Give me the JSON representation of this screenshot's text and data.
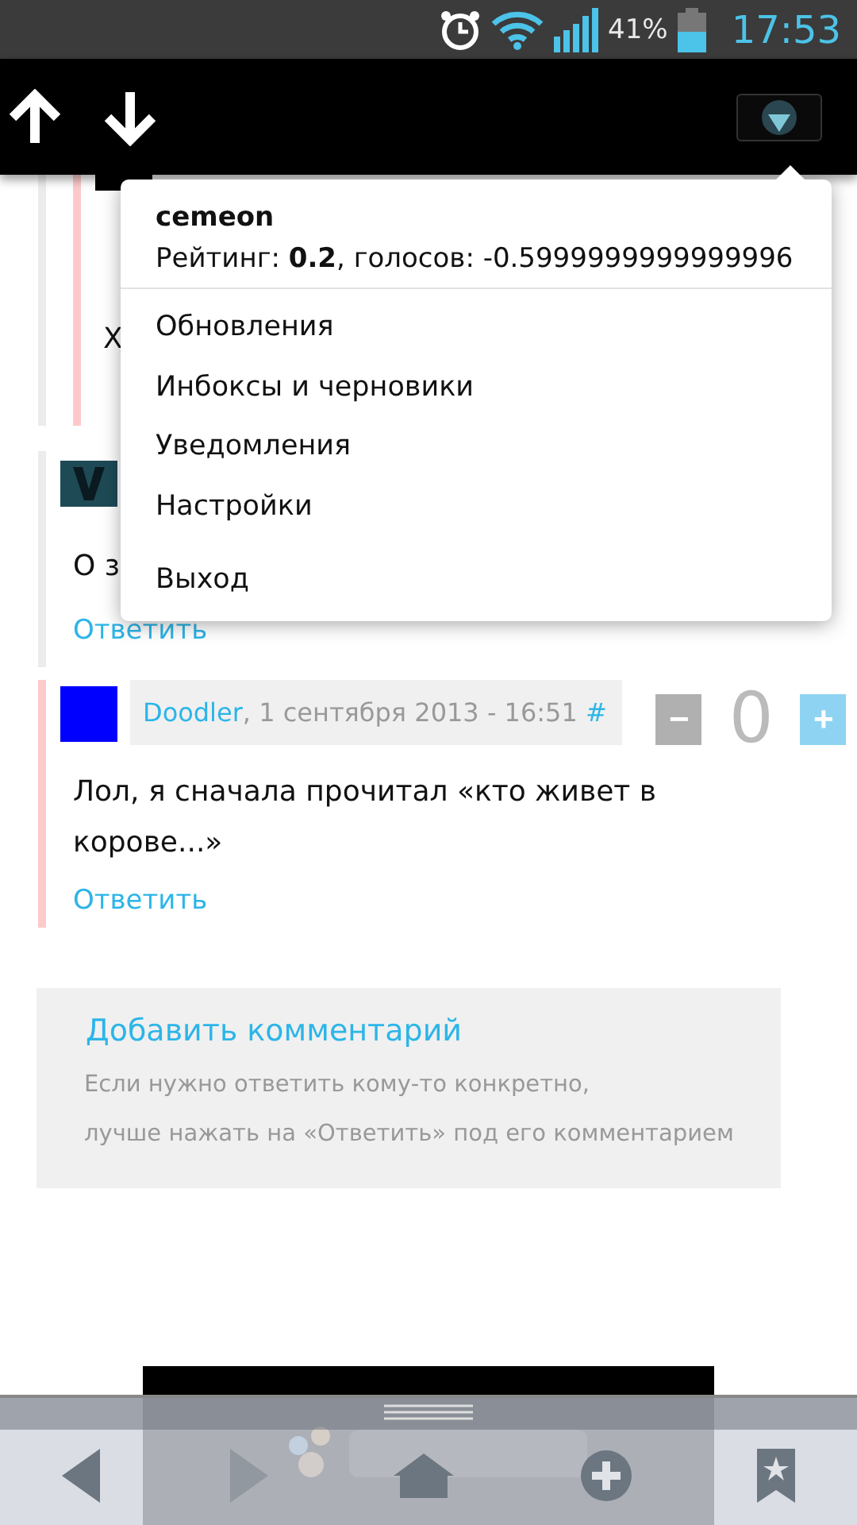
{
  "status_bar": {
    "battery": "41%",
    "time": "17:53"
  },
  "comments": [
    {
      "kind": "hidden",
      "color": "#000000",
      "new": true,
      "text": "Х"
    },
    {
      "kind": "short",
      "color": "#1e4a55",
      "new": false,
      "text": "О з",
      "reply": "Ответить"
    },
    {
      "kind": "full",
      "color": "#0000ff",
      "new": true,
      "author": "Doodler",
      "meta": ", 1 сентября 2013 - 16:51",
      "anchor": "#",
      "minus": "−",
      "score": "0",
      "plus": "+",
      "text": "Лол, я сначала прочитал «кто живет в корове...»",
      "reply": "Ответить"
    }
  ],
  "add_comment": {
    "title": "Добавить комментарий",
    "hint_lines": [
      "Если нужно ответить кому-то конкретно,",
      "лучше нажать на «Ответить» под его комментарием"
    ]
  },
  "user_menu": {
    "username": "cemeon",
    "rating": "Рейтинг: **0.2**, голосов: -0.5999999999999996",
    "items": [
      {
        "kind": "link",
        "label": "Обновления"
      },
      {
        "kind": "link",
        "label": "Инбоксы и черновики"
      },
      {
        "kind": "link",
        "label": "Уведомления"
      },
      {
        "kind": "link",
        "label": "Настройки"
      },
      {
        "kind": "exit",
        "label": "Выход"
      }
    ]
  },
  "bottom_bar": [
    {
      "kind": "back",
      "disabled": false
    },
    {
      "kind": "forward",
      "disabled": true
    },
    {
      "kind": "home",
      "disabled": false
    },
    {
      "kind": "add",
      "disabled": false
    },
    {
      "kind": "bookmarks",
      "disabled": false
    }
  ]
}
